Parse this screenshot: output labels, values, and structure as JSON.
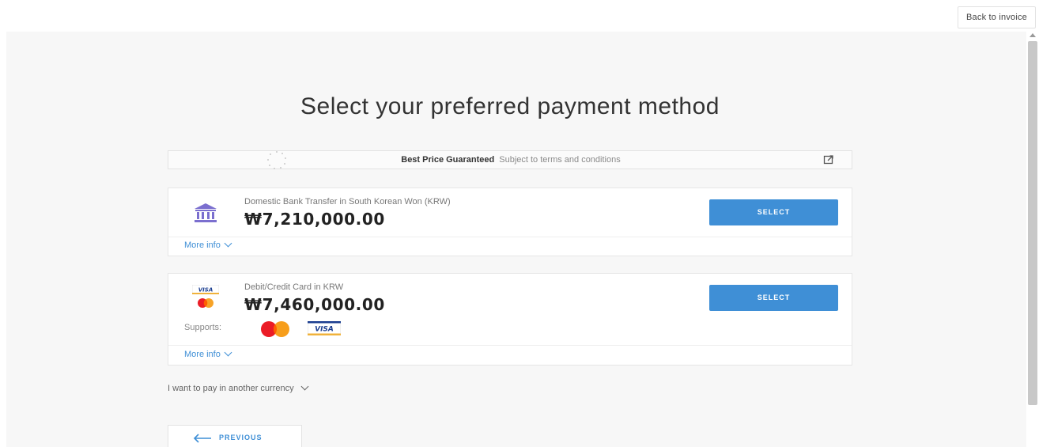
{
  "header": {
    "back_label": "Back to invoice"
  },
  "page": {
    "title": "Select your preferred payment method"
  },
  "guarantee": {
    "strong": "Best Price Guaranteed",
    "sub": "Subject to terms and conditions"
  },
  "methods": [
    {
      "title": "Domestic Bank Transfer in South Korean Won (KRW)",
      "amount": "₩7,210,000.00",
      "select_label": "SELECT",
      "more_info_label": "More info",
      "icon": "bank-icon"
    },
    {
      "title": "Debit/Credit Card in KRW",
      "amount": "₩7,460,000.00",
      "select_label": "SELECT",
      "more_info_label": "More info",
      "supports_label": "Supports:",
      "icon": "card-icon",
      "brands": [
        "mastercard",
        "visa"
      ]
    }
  ],
  "other_currency": {
    "label": "I want to pay in another currency"
  },
  "nav": {
    "previous_label": "PREVIOUS"
  },
  "colors": {
    "accent": "#3f8fd6",
    "background": "#f7f7f7",
    "bank_icon": "#7b6fcf"
  }
}
